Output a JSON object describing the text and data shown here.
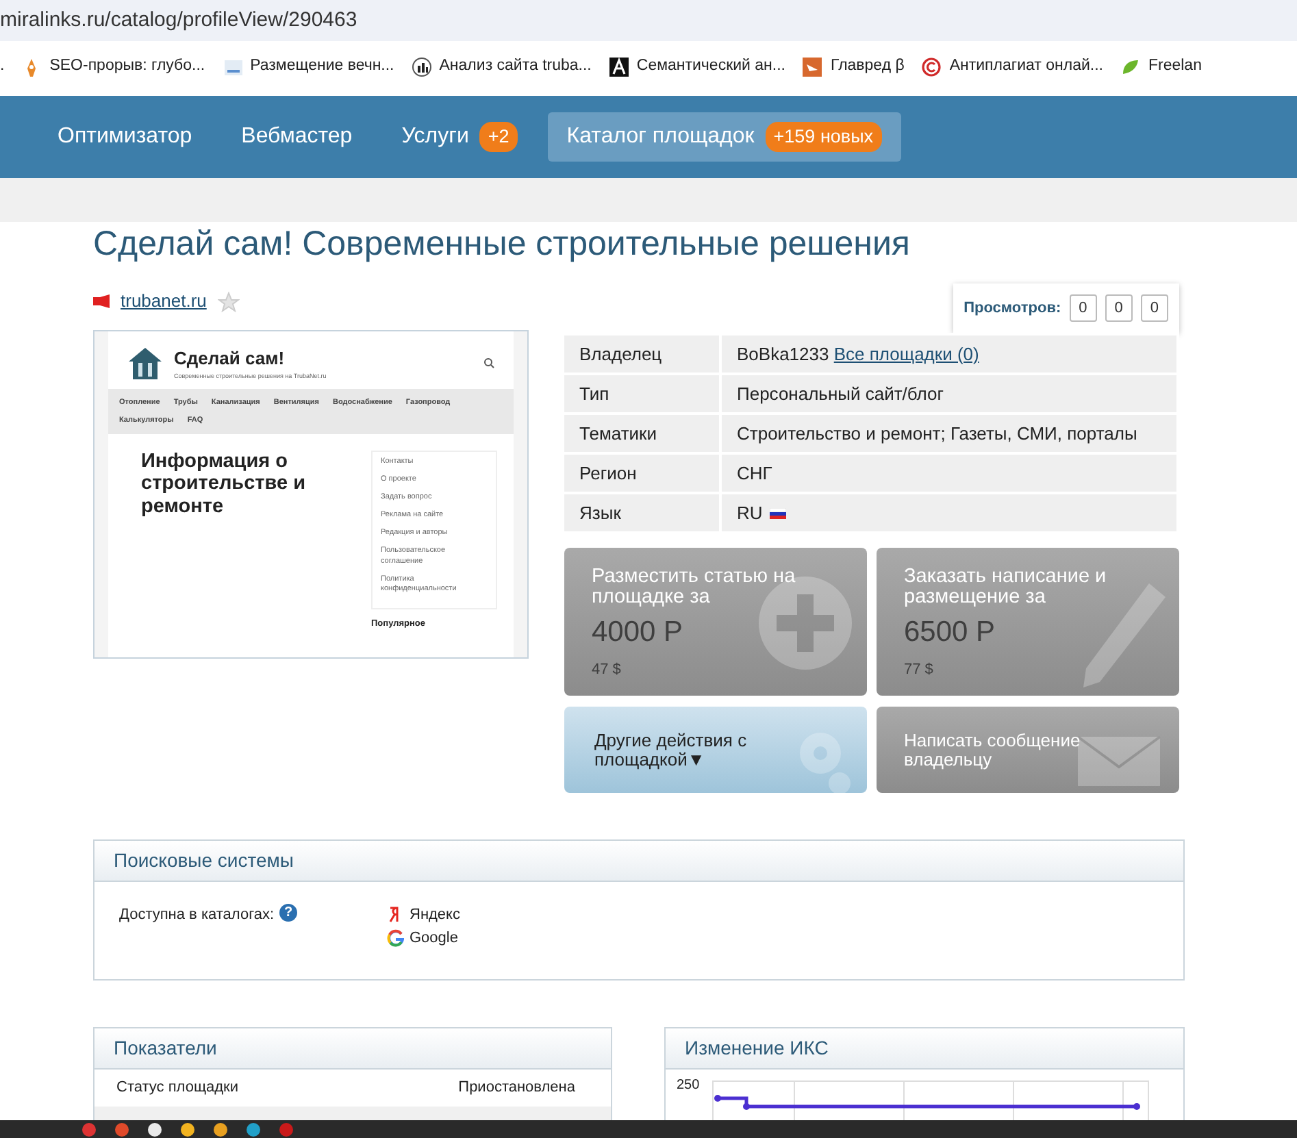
{
  "browser": {
    "url": "miralinks.ru/catalog/profileView/290463",
    "bookmarks": [
      {
        "label": "."
      },
      {
        "label": "SEO-прорыв: глубо..."
      },
      {
        "label": "Размещение вечн..."
      },
      {
        "label": "Анализ сайта truba..."
      },
      {
        "label": "Семантический ан..."
      },
      {
        "label": "Главред β"
      },
      {
        "label": "Антиплагиат онлай..."
      },
      {
        "label": "Freelan"
      }
    ]
  },
  "nav": [
    {
      "label": "Оптимизатор",
      "selected": false
    },
    {
      "label": "Вебмастер",
      "selected": false
    },
    {
      "label": "Услуги",
      "badge": "+2",
      "selected": false
    },
    {
      "label": "Каталог площадок",
      "badge": "+159 новых",
      "selected": true
    }
  ],
  "title": "Сделай сам! Современные строительные решения",
  "site": {
    "domain": "trubanet.ru",
    "favorite": false
  },
  "views": {
    "label": "Просмотров:",
    "counts": [
      "0",
      "0",
      "0"
    ]
  },
  "preview": {
    "site_title": "Сделай сам!",
    "tagline": "Современные строительные решения на TrubaNet.ru",
    "menu": [
      "Отопление",
      "Трубы",
      "Канализация",
      "Вентиляция",
      "Водоснабжение",
      "Газопровод",
      "Калькуляторы",
      "FAQ"
    ],
    "heading": "Информация о строительстве и ремонте",
    "sidebar": [
      "Контакты",
      "О проекте",
      "Задать вопрос",
      "Реклама на сайте",
      "Редакция и авторы",
      "Пользовательское соглашение",
      "Политика конфиденциальности"
    ],
    "section": "Популярное"
  },
  "info": [
    {
      "label": "Владелец",
      "value": "BoBka1233",
      "link": "Все площадки (0)",
      "flag": false
    },
    {
      "label": "Тип",
      "value": "Персональный сайт/блог",
      "flag": false
    },
    {
      "label": "Тематики",
      "value": "Строительство и ремонт; Газеты, СМИ, порталы",
      "flag": false
    },
    {
      "label": "Регион",
      "value": "СНГ",
      "flag": false
    },
    {
      "label": "Язык",
      "value": "RU",
      "flag": true
    }
  ],
  "actions": [
    {
      "kind": "price",
      "label": "Разместить статью на площадке за",
      "price": "4000 Р",
      "usd": "47 $",
      "disabled": true
    },
    {
      "kind": "price",
      "label": "Заказать написание и размещение за",
      "price": "6500 Р",
      "usd": "77 $",
      "disabled": true
    },
    {
      "kind": "menu",
      "label": "Другие действия с площадкой▼",
      "disabled": false
    },
    {
      "kind": "plain",
      "label": "Написать сообщение владельцу",
      "disabled": true
    }
  ],
  "search_engines": {
    "title": "Поисковые системы",
    "label": "Доступна в каталогах:",
    "help": "?",
    "catalogs": [
      {
        "name": "Яндекс"
      },
      {
        "name": "Google"
      }
    ]
  },
  "indicators": {
    "title": "Показатели",
    "rows": [
      {
        "label": "Статус площадки",
        "value": "Приостановлена"
      }
    ]
  },
  "iks_chart": {
    "title": "Изменение ИКС",
    "tick_labels": [
      "250"
    ]
  }
}
